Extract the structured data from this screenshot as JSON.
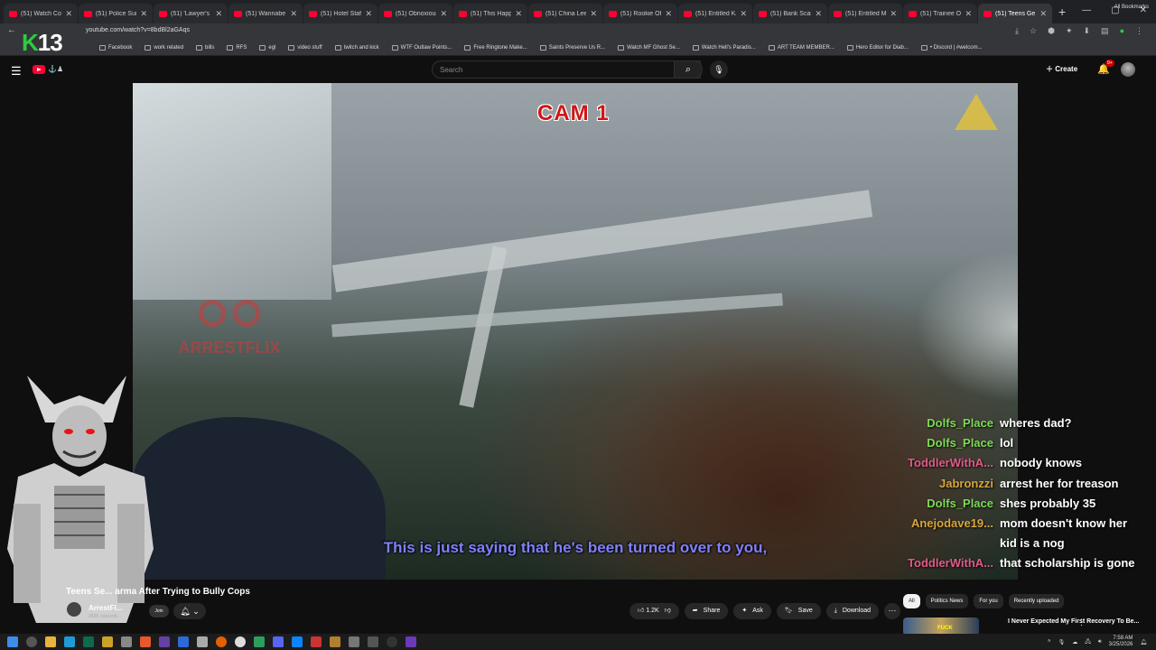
{
  "browser": {
    "tabs": [
      {
        "title": "(51) Watch Cop C"
      },
      {
        "title": "(51) Police Surpri"
      },
      {
        "title": "(51) 'Lawyer's Wil"
      },
      {
        "title": "(51) Wannabe Gr"
      },
      {
        "title": "(51) Hotel Staff S"
      },
      {
        "title": "(51) Obnoxious"
      },
      {
        "title": "(51) This Happen"
      },
      {
        "title": "(51) China Lee Bl"
      },
      {
        "title": "(51) Rookie Offic"
      },
      {
        "title": "(51) Entitled Kare"
      },
      {
        "title": "(51) Bank Scamm"
      },
      {
        "title": "(51) Entitled Man"
      },
      {
        "title": "(51) Trainee Offic"
      },
      {
        "title": "(51) Teens Ge"
      }
    ],
    "url": "youtube.com/watch?v=8bdBl2aGAqs",
    "bookmarks": [
      "Facebook",
      "work related",
      "bills",
      "RFS",
      "egl",
      "video stuff",
      "twitch and kick",
      "WTF Outlaw Points...",
      "Free Ringtone Make...",
      "Saints Preserve Us R...",
      "Watch MF Ghost Se...",
      "Watch Hell's Paradis...",
      "ART TEAM MEMBER...",
      "Hero Editor for Diab...",
      "• Discord | #welcom..."
    ],
    "all_bookmarks": "All Bookmarks"
  },
  "overlay": {
    "k13_k": "K",
    "k13_num": "13"
  },
  "youtube": {
    "brand": "⚓♟",
    "search_placeholder": "Search",
    "create_label": "Create",
    "notif_badge": "9+"
  },
  "video": {
    "cam_label": "CAM 1",
    "watermark": "ARRESTFLIX",
    "caption": "This is just saying that he's been turned over to you,",
    "title": "Teens Se... arma After Trying to Bully Cops",
    "channel_name": "ArrestFl...",
    "subscribers": "283K subscrib...",
    "join_label": "Join"
  },
  "chat": [
    {
      "name": "Dolfs_Place",
      "msg": "wheres dad?",
      "color": "#7ed957"
    },
    {
      "name": "Dolfs_Place",
      "msg": "lol",
      "color": "#7ed957"
    },
    {
      "name": "ToddlerWithA...",
      "msg": "nobody knows",
      "color": "#e05a8a"
    },
    {
      "name": "Jabronzzi",
      "msg": "arrest her for treason",
      "color": "#d8a53c"
    },
    {
      "name": "Dolfs_Place",
      "msg": "shes probably 35",
      "color": "#7ed957"
    },
    {
      "name": "Anejodave19...",
      "msg": "mom doesn't know her kid is a nog",
      "color": "#d8a53c"
    },
    {
      "name": "ToddlerWithA...",
      "msg": "that scholarship is gone",
      "color": "#e05a8a"
    }
  ],
  "actions": {
    "likes": "1.2K",
    "share": "Share",
    "ask": "Ask",
    "save": "Save",
    "download": "Download"
  },
  "filters": [
    "All",
    "Politics News",
    "For you",
    "Recently uploaded"
  ],
  "recommended": {
    "title": "I Never Expected My First Recovery To Be...",
    "thumb_text": "FUCK"
  },
  "taskbar": {
    "time": "7:58 AM",
    "date": "3/25/2026"
  }
}
